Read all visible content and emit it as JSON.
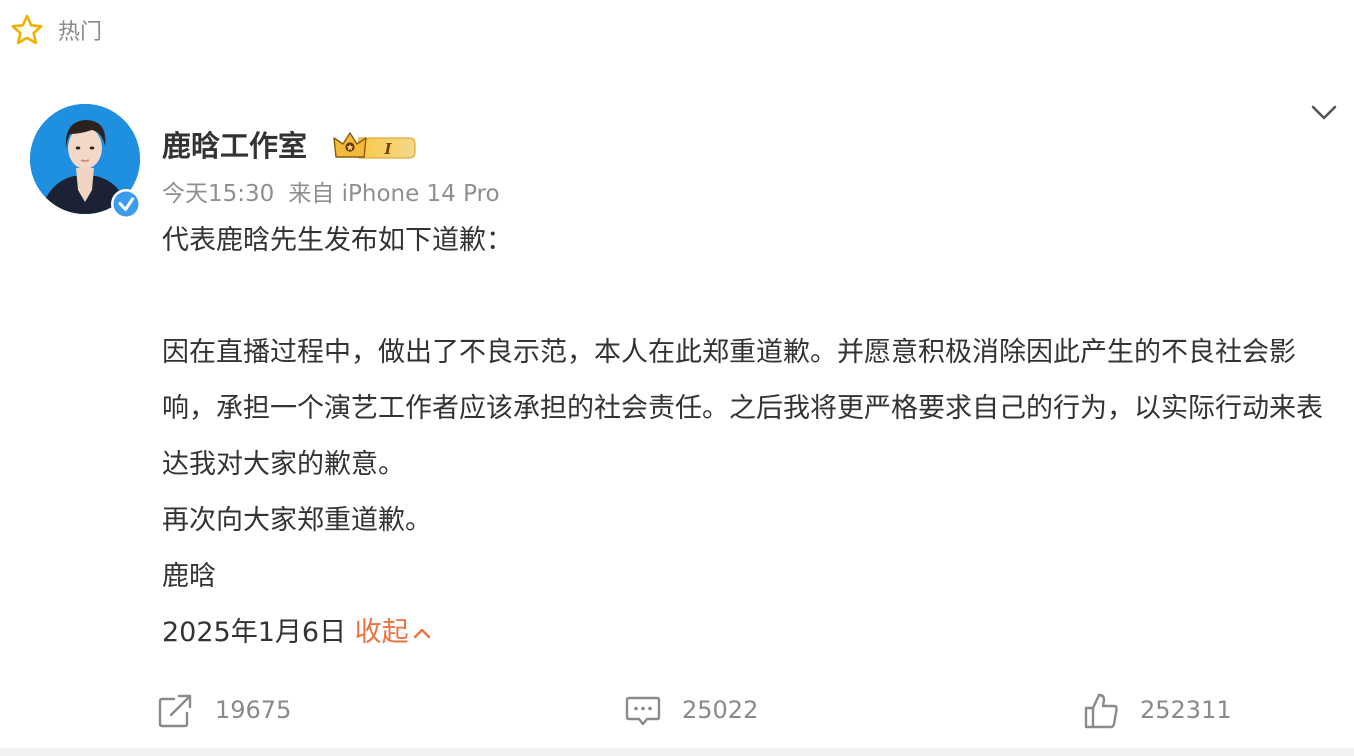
{
  "section": {
    "label": "热门",
    "icon": "star-icon",
    "icon_color": "#f0b000"
  },
  "post": {
    "author": "鹿晗工作室",
    "vip_badge": {
      "icon": "vip-crown-badge-icon",
      "text": "I"
    },
    "verified_color": "#3d9bef",
    "time": "今天15:30",
    "source": "来自 iPhone 14 Pro",
    "content": [
      "代表鹿晗先生发布如下道歉：",
      "",
      "因在直播过程中，做出了不良示范，本人在此郑重道歉。并愿意积极消除因此产生的不良社会影响，承担一个演艺工作者应该承担的社会责任。之后我将更严格要求自己的行为，以实际行动来表达我对大家的歉意。",
      "再次向大家郑重道歉。",
      "鹿晗",
      "2025年1月6日"
    ],
    "collapse_label": "收起",
    "link_color": "#eb7340"
  },
  "actions": {
    "repost": {
      "icon": "share-icon",
      "count": "19675"
    },
    "comment": {
      "icon": "comment-icon",
      "count": "25022"
    },
    "like": {
      "icon": "thumbs-up-icon",
      "count": "252311"
    }
  }
}
